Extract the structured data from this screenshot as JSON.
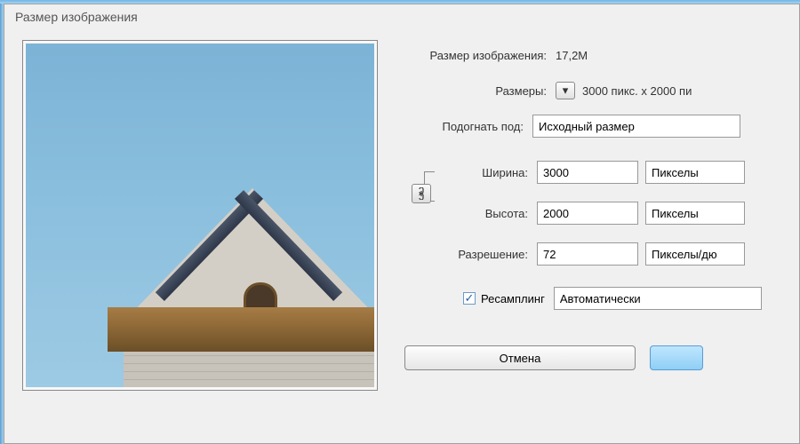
{
  "dialog": {
    "title": "Размер изображения"
  },
  "info": {
    "size_label": "Размер изображения:",
    "size_value": "17,2M",
    "dims_label": "Размеры:",
    "dims_value": "3000 пикс. x 2000 пи"
  },
  "fit": {
    "label": "Подогнать под:",
    "value": "Исходный размер"
  },
  "width": {
    "label": "Ширина:",
    "value": "3000",
    "unit": "Пикселы"
  },
  "height": {
    "label": "Высота:",
    "value": "2000",
    "unit": "Пикселы"
  },
  "resolution": {
    "label": "Разрешение:",
    "value": "72",
    "unit": "Пикселы/дю"
  },
  "resample": {
    "label": "Ресамплинг",
    "method": "Автоматически"
  },
  "buttons": {
    "cancel": "Отмена"
  }
}
